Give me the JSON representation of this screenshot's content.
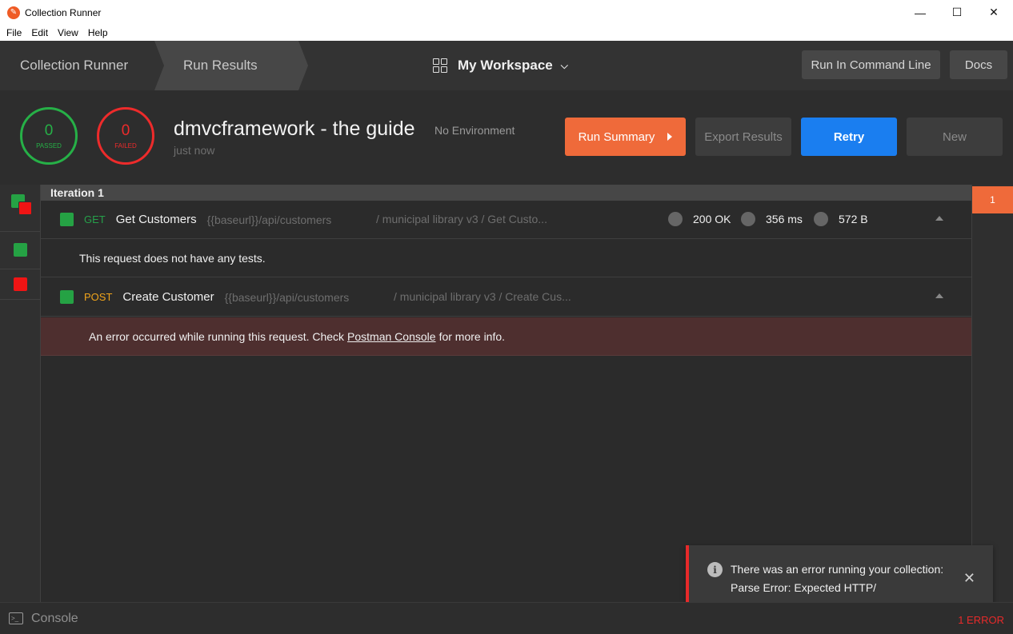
{
  "window": {
    "title": "Collection Runner",
    "controls": {
      "minimize": "—",
      "maximize": "☐",
      "close": "✕"
    }
  },
  "menu": [
    "File",
    "Edit",
    "View",
    "Help"
  ],
  "header": {
    "crumb_runner": "Collection Runner",
    "crumb_results": "Run Results",
    "workspace": "My Workspace",
    "run_cli": "Run In Command Line",
    "docs": "Docs"
  },
  "summary": {
    "passed_count": "0",
    "passed_label": "PASSED",
    "failed_count": "0",
    "failed_label": "FAILED",
    "collection_name": "dmvcframework - the guide",
    "time": "just now",
    "environment": "No Environment",
    "run_summary": "Run Summary",
    "export": "Export Results",
    "retry": "Retry",
    "new": "New"
  },
  "iteration": {
    "label": "Iteration 1",
    "tab": "1"
  },
  "requests": [
    {
      "method": "GET",
      "name": "Get Customers",
      "url": "{{baseurl}}/api/customers",
      "path": "/ municipal library v3 / Get Custo...",
      "status": "200 OK",
      "time": "356 ms",
      "size": "572 B",
      "note": "This request does not have any tests."
    },
    {
      "method": "POST",
      "name": "Create Customer",
      "url": "{{baseurl}}/api/customers",
      "path": "/ municipal library v3 / Create Cus..."
    }
  ],
  "error_row": {
    "before": "An error occurred while running this request. Check",
    "link": "Postman Console",
    "after": "for more info."
  },
  "toast": {
    "message": "There was an error running your collection: Parse Error: Expected HTTP/",
    "info": "i",
    "close": "✕"
  },
  "footer": {
    "console": "Console",
    "errors": "1 ERROR"
  },
  "colors": {
    "accent_orange": "#ef6a3a",
    "retry_blue": "#1a7ef0",
    "pass_green": "#26b047",
    "fail_red": "#ed2b2b"
  }
}
